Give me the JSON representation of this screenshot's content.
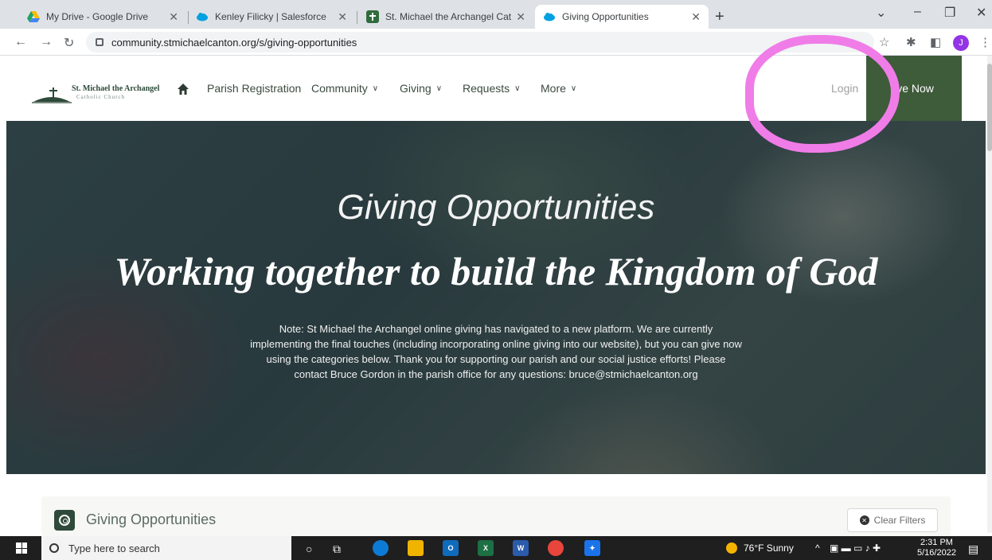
{
  "browser": {
    "tabs": [
      {
        "title": "My Drive - Google Drive",
        "close": "✕",
        "active": false
      },
      {
        "title": "Kenley Filicky | Salesforce",
        "close": "✕",
        "active": false
      },
      {
        "title": "St. Michael the Archangel Cathol",
        "close": "✕",
        "active": false
      },
      {
        "title": "Giving Opportunities",
        "close": "✕",
        "active": true
      }
    ],
    "new_tab": "+",
    "url": "community.stmichaelcanton.org/s/giving-opportunities",
    "profile_initial": "J"
  },
  "site": {
    "logo_name": "St. Michael the Archangel",
    "logo_sub": "Catholic Church",
    "nav": [
      {
        "label": "Parish Registration",
        "dropdown": false
      },
      {
        "label": "Community",
        "dropdown": true
      },
      {
        "label": "Giving",
        "dropdown": true
      },
      {
        "label": "Requests",
        "dropdown": true
      },
      {
        "label": "More",
        "dropdown": true
      }
    ],
    "login": "Login",
    "give_now": "ive Now",
    "brand_green": "#3e5b3a",
    "annotation_color": "#f07ce8"
  },
  "hero": {
    "title": "Giving Opportunities",
    "subtitle": "Working together to build the Kingdom of God",
    "note": "Note: St Michael the Archangel online giving has navigated to a new platform. We are currently implementing the final touches (including incorporating online giving into our website), but you can give now using the categories below. Thank you for supporting our parish and our social justice efforts! Please contact Bruce Gordon in the parish office for any questions: bruce@stmichaelcanton.org"
  },
  "section": {
    "title": "Giving Opportunities",
    "clear_filters": "Clear Filters"
  },
  "taskbar": {
    "search_placeholder": "Type here to search",
    "weather": "76°F  Sunny",
    "time": "2:31 PM",
    "date": "5/16/2022"
  }
}
